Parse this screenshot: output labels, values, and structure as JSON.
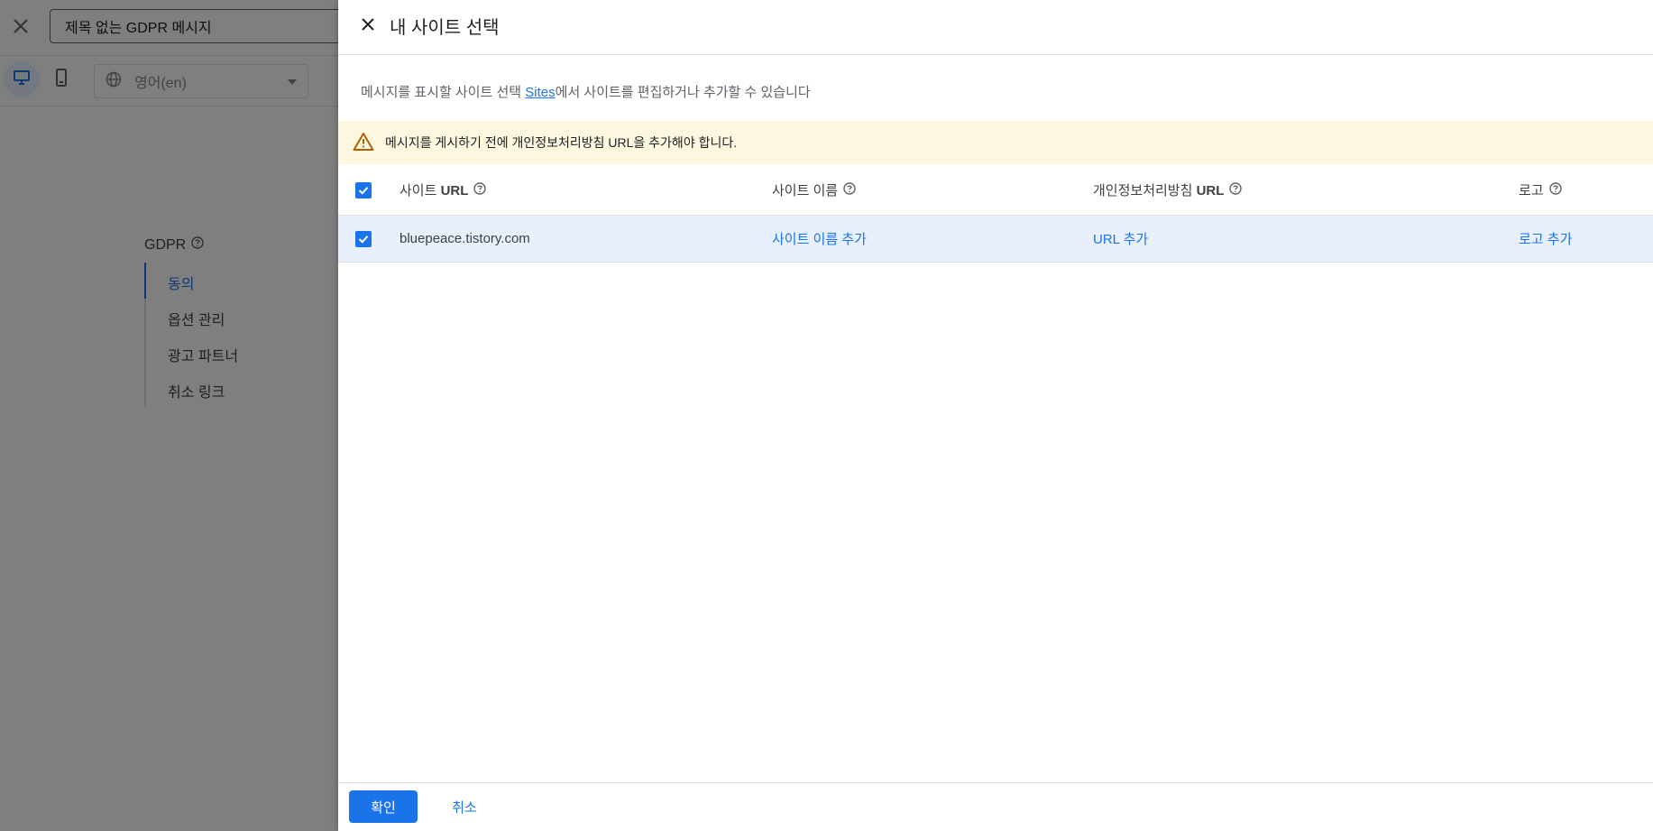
{
  "background": {
    "title_input_value": "제목 없는 GDPR 메시지",
    "language_value": "영어(en)",
    "nav": {
      "title": "GDPR",
      "items": [
        "동의",
        "옵션 관리",
        "광고 파트너",
        "취소 링크"
      ]
    }
  },
  "panel": {
    "title": "내 사이트 선택",
    "description_prefix": "메시지를 표시할 사이트 선택 ",
    "description_link": "Sites",
    "description_suffix": "에서 사이트를 편집하거나 추가할 수 있습니다",
    "warning": "메시지를 게시하기 전에 개인정보처리방침 URL을 추가해야 합니다.",
    "table": {
      "headers": {
        "url_prefix": "사이트 ",
        "url_bold": "URL",
        "name": "사이트 이름",
        "privacy_prefix": "개인정보처리방침 ",
        "privacy_bold": "URL",
        "logo": "로고"
      },
      "rows": [
        {
          "url": "bluepeace.tistory.com",
          "name_action": "사이트 이름 추가",
          "privacy_action": "URL 추가",
          "logo_action": "로고 추가",
          "checked": true
        }
      ]
    },
    "footer": {
      "confirm_label": "확인",
      "cancel_label": "취소"
    }
  },
  "colors": {
    "accent": "#1a73e8",
    "warning_bg": "#fef7e0",
    "warning_icon": "#b06000",
    "selected_row_bg": "#e8f0fe"
  }
}
